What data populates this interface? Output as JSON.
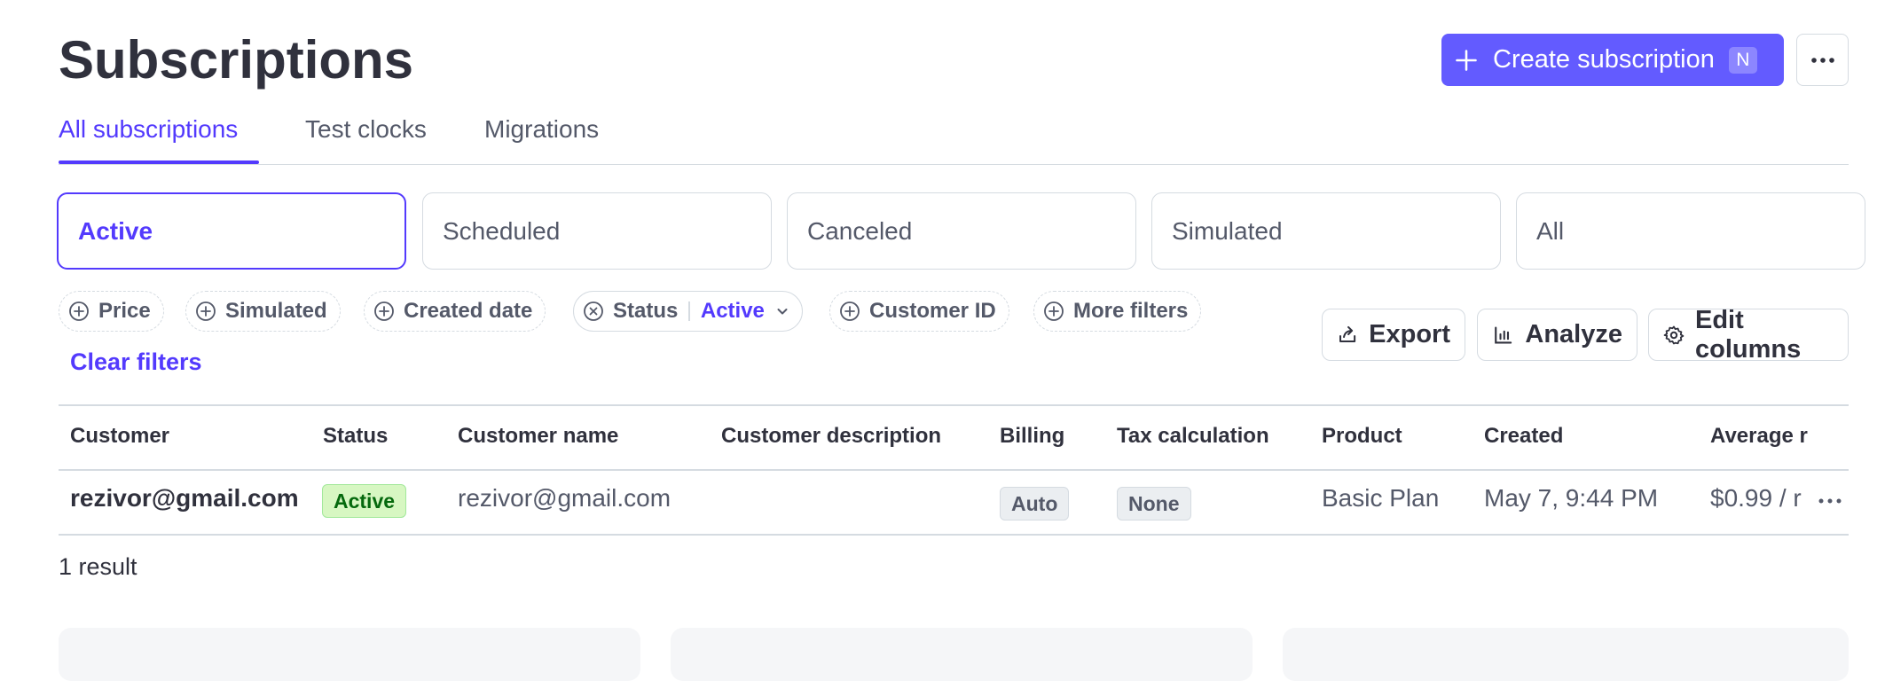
{
  "page": {
    "title": "Subscriptions"
  },
  "header": {
    "create_label": "Create subscription",
    "create_shortcut": "N"
  },
  "tabs": [
    "All subscriptions",
    "Test clocks",
    "Migrations"
  ],
  "status_cards": [
    "Active",
    "Scheduled",
    "Canceled",
    "Simulated",
    "All"
  ],
  "filters": {
    "chips": [
      "Price",
      "Simulated",
      "Created date",
      "Customer ID",
      "More filters"
    ],
    "status_label": "Status",
    "status_value": "Active",
    "clear_label": "Clear filters"
  },
  "toolbar": {
    "export": "Export",
    "analyze": "Analyze",
    "edit_columns": "Edit columns"
  },
  "table": {
    "columns": [
      "Customer",
      "Status",
      "Customer name",
      "Customer description",
      "Billing",
      "Tax calculation",
      "Product",
      "Created",
      "Average r"
    ],
    "rows": [
      {
        "customer": "rezivor@gmail.com",
        "status": "Active",
        "customer_name": "rezivor@gmail.com",
        "customer_description": "",
        "billing": "Auto",
        "tax": "None",
        "product": "Basic Plan",
        "created": "May 7, 9:44 PM",
        "average": "$0.99 / r"
      }
    ]
  },
  "result_count": "1 result",
  "colors": {
    "accent": "#533afd",
    "button": "#635bff",
    "active_badge_bg": "#d7f7c2",
    "active_badge_text": "#05690d"
  }
}
